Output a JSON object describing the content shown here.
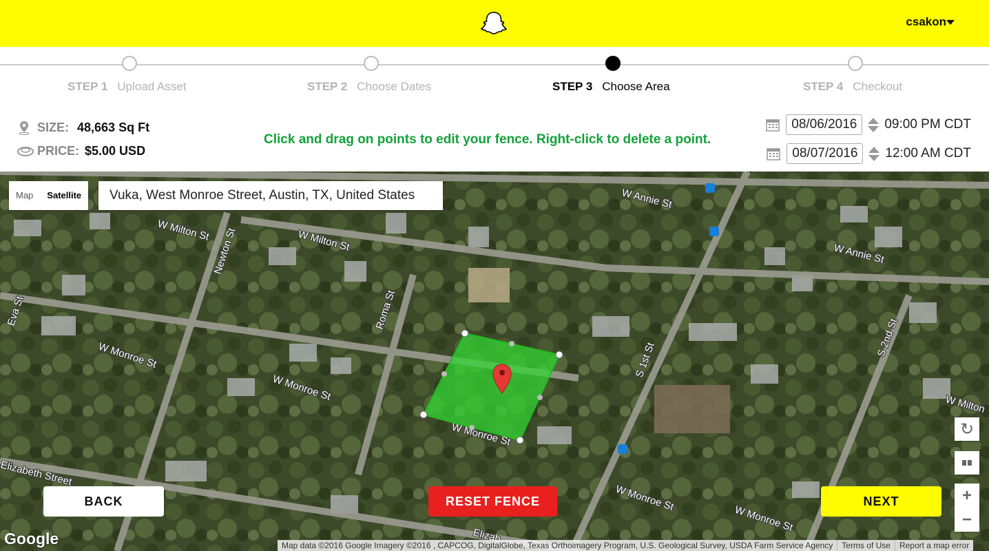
{
  "header": {
    "username": "csakon",
    "logo": "snapchat-ghost-icon",
    "brand_color": "#FFFC00"
  },
  "steps": [
    {
      "num": "STEP 1",
      "label": "Upload Asset",
      "active": false
    },
    {
      "num": "STEP 2",
      "label": "Choose Dates",
      "active": false
    },
    {
      "num": "STEP 3",
      "label": "Choose Area",
      "active": true
    },
    {
      "num": "STEP 4",
      "label": "Checkout",
      "active": false
    }
  ],
  "info": {
    "size_label": "SIZE:",
    "size_value": "48,663 Sq Ft",
    "price_label": "PRICE:",
    "price_value": "$5.00 USD",
    "hint": "Click and drag on points to edit your fence. Right-click to delete a point.",
    "hint_color": "#13a13a",
    "start_date": "08/06/2016",
    "start_time": "09:00 PM CDT",
    "end_date": "08/07/2016",
    "end_time": "12:00 AM CDT"
  },
  "map": {
    "type_map": "Map",
    "type_satellite": "Satellite",
    "search_value": "Vuka, West Monroe Street, Austin, TX, United States",
    "streets": [
      "W Annie St",
      "W Milton St",
      "W Milton St",
      "Newton St",
      "W Annie St",
      "Eva St",
      "Roma St",
      "W Monroe St",
      "W Monroe St",
      "S 1st St",
      "S 2nd St",
      "W Milton",
      "W Monroe St",
      "Elizabeth Street",
      "W Monroe St",
      "W Monroe St",
      "Elizab"
    ],
    "google_logo": "Google",
    "attribution": "Map data ©2016 Google Imagery ©2016 , CAPCOG, DigitalGlobe, Texas Orthoimagery Program, U.S. Geological Survey, USDA Farm Service Agency",
    "terms": "Terms of Use",
    "report": "Report a map error"
  },
  "buttons": {
    "back": "BACK",
    "reset": "RESET FENCE",
    "next": "NEXT"
  },
  "controls": {
    "zoom_in": "+",
    "zoom_out": "−"
  }
}
